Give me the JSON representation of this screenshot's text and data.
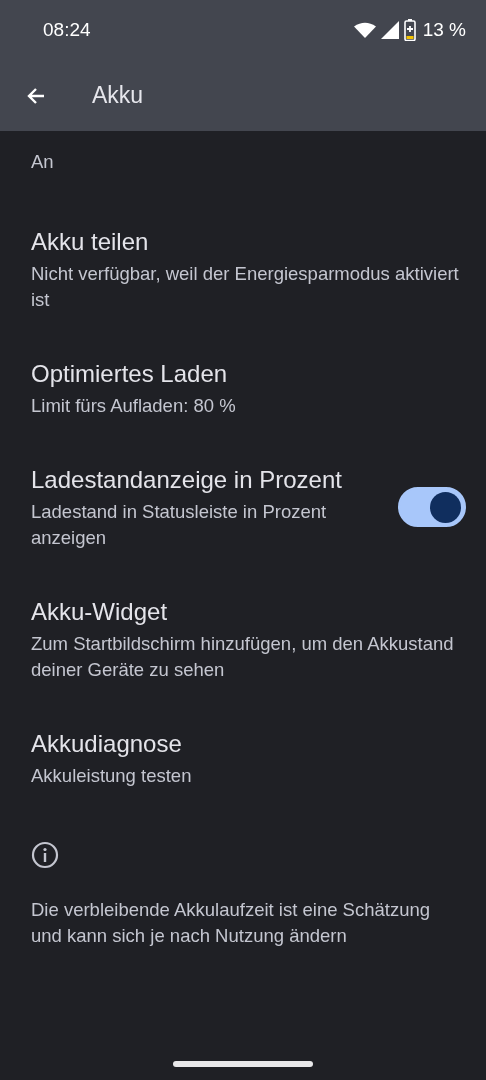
{
  "status_bar": {
    "time": "08:24",
    "battery": "13 %"
  },
  "app_bar": {
    "title": "Akku"
  },
  "items": [
    {
      "kind": "text",
      "subtitle": "An"
    },
    {
      "kind": "text",
      "title": "Akku teilen",
      "subtitle": "Nicht verfügbar, weil der Energiesparmodus aktiviert ist"
    },
    {
      "kind": "text",
      "title": "Optimiertes Laden",
      "subtitle": "Limit fürs Aufladen: 80 %"
    },
    {
      "kind": "switch",
      "title": "Ladestandanzeige in Prozent",
      "subtitle": "Ladestand in Statusleiste in Prozent anzeigen",
      "on": true
    },
    {
      "kind": "text",
      "title": "Akku-Widget",
      "subtitle": "Zum Startbildschirm hinzufügen, um den Akkustand deiner Geräte zu sehen"
    },
    {
      "kind": "text",
      "title": "Akkudiagnose",
      "subtitle": "Akkuleistung testen"
    }
  ],
  "footer": {
    "text": "Die verbleibende Akkulaufzeit ist eine Schätzung und kann sich je nach Nutzung ändern"
  }
}
